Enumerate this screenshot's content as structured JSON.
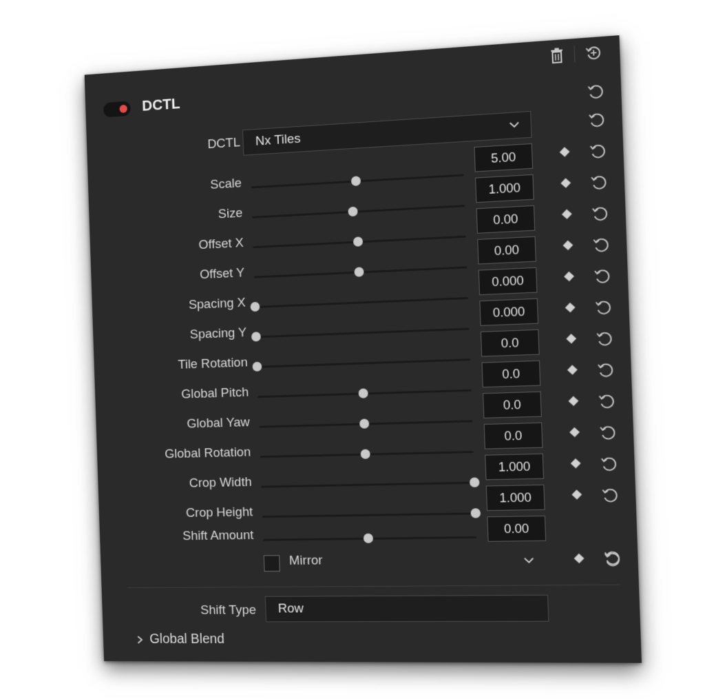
{
  "panel": {
    "title": "DCTL",
    "enabled": true,
    "accent_color": "#e54b4b",
    "header_icons": [
      "trash-icon",
      "reset-all-icon"
    ]
  },
  "dctl_select": {
    "label": "DCTL",
    "value": "Nx Tiles"
  },
  "params": [
    {
      "label": "Scale",
      "value": "5.00",
      "slider": 0.5
    },
    {
      "label": "Size",
      "value": "1.000",
      "slider": 0.48
    },
    {
      "label": "Offset X",
      "value": "0.00",
      "slider": 0.5
    },
    {
      "label": "Offset Y",
      "value": "0.00",
      "slider": 0.5
    },
    {
      "label": "Spacing X",
      "value": "0.000",
      "slider": 0.0
    },
    {
      "label": "Spacing Y",
      "value": "0.000",
      "slider": 0.0
    },
    {
      "label": "Tile Rotation",
      "value": "0.0",
      "slider": 0.0
    },
    {
      "label": "Global Pitch",
      "value": "0.0",
      "slider": 0.5
    },
    {
      "label": "Global Yaw",
      "value": "0.0",
      "slider": 0.5
    },
    {
      "label": "Global Rotation",
      "value": "0.0",
      "slider": 0.5
    },
    {
      "label": "Crop Width",
      "value": "1.000",
      "slider": 1.0
    },
    {
      "label": "Crop Height",
      "value": "1.000",
      "slider": 1.0
    },
    {
      "label": "Shift Amount",
      "value": "0.00",
      "slider": 0.5
    }
  ],
  "mirror": {
    "label": "Mirror",
    "checked": false
  },
  "shift_type": {
    "label": "Shift Type",
    "value": "Row"
  },
  "footer": {
    "label": "Global Blend"
  }
}
